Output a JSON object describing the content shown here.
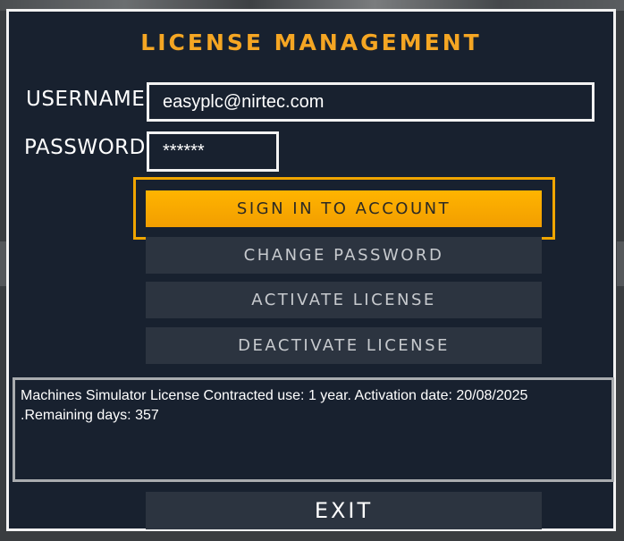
{
  "dialog": {
    "title": "LICENSE MANAGEMENT"
  },
  "form": {
    "username_label": "USERNAME",
    "username_value": "easyplc@nirtec.com",
    "password_label": "PASSWORD",
    "password_value": "******"
  },
  "buttons": {
    "sign_in": "SIGN IN TO ACCOUNT",
    "change_password": "CHANGE PASSWORD",
    "activate_license": "ACTIVATE LICENSE",
    "deactivate_license": "DEACTIVATE LICENSE",
    "exit": "EXIT"
  },
  "info": {
    "line1": "Machines Simulator License Contracted use: 1 year. Activation date: 20/08/2025",
    "line2": ".Remaining days: 357"
  },
  "colors": {
    "accent": "#f5a623",
    "dialog_bg": "#18212f",
    "button_bg": "#2c3440",
    "sign_in_bg": "#f7a800"
  }
}
